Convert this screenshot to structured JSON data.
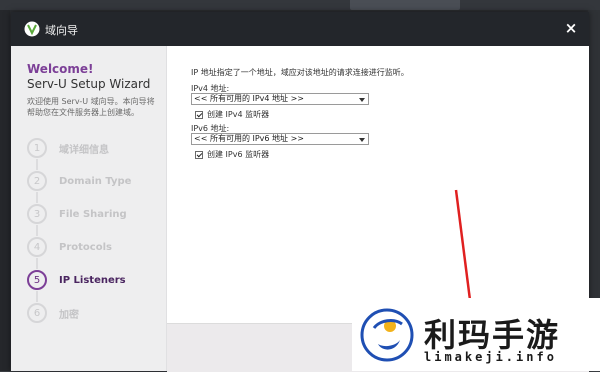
{
  "window": {
    "title": "域向导",
    "close_label": "×"
  },
  "sidebar": {
    "welcome": "Welcome!",
    "wizard_title": "Serv-U Setup Wizard",
    "description": "欢迎使用 Serv-U 域向导。本向导将帮助您在文件服务器上创建域。",
    "steps": [
      {
        "number": "1",
        "label": "域详细信息",
        "active": false
      },
      {
        "number": "2",
        "label": "Domain Type",
        "active": false
      },
      {
        "number": "3",
        "label": "File Sharing",
        "active": false
      },
      {
        "number": "4",
        "label": "Protocols",
        "active": false
      },
      {
        "number": "5",
        "label": "IP Listeners",
        "active": true
      },
      {
        "number": "6",
        "label": "加密",
        "active": false
      }
    ]
  },
  "content": {
    "intro": "IP 地址指定了一个地址，域应对该地址的请求连接进行监听。",
    "ipv4": {
      "label": "IPv4 地址:",
      "select_value": "<< 所有可用的 IPv4 地址 >>",
      "checkbox_label": "创建 IPv4 监听器",
      "checked": true
    },
    "ipv6": {
      "label": "IPv6 地址:",
      "select_value": "<< 所有可用的 IPv6 地址 >>",
      "checkbox_label": "创建 IPv6 监听器",
      "checked": true
    }
  },
  "watermark": {
    "title": "利玛手游",
    "url": "limakeji.info"
  },
  "colors": {
    "accent": "#7c3f97",
    "titlebar": "#23262b",
    "sidebar_bg": "#eeeeef",
    "annotation_arrow": "#e02020"
  }
}
